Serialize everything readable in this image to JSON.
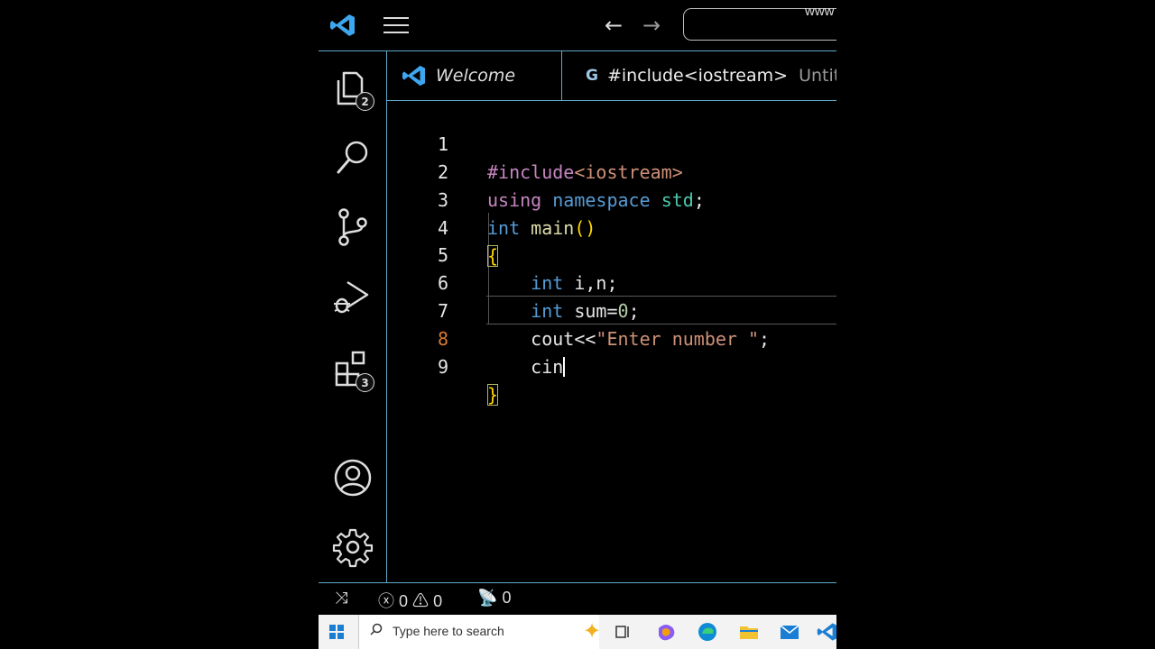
{
  "titlebar": {
    "search_text": "www",
    "back_icon": "arrow-left",
    "forward_icon": "arrow-right"
  },
  "activity_bar": {
    "explorer_badge": "2",
    "extensions_badge": "3"
  },
  "tabs": [
    {
      "label": "Welcome"
    },
    {
      "label": "#include<iostream>",
      "description": "Untitle"
    }
  ],
  "editor": {
    "active_line": 8,
    "lines": [
      {
        "num": "1",
        "code": "#include<iostream>"
      },
      {
        "num": "2",
        "code": "using namespace std;"
      },
      {
        "num": "3",
        "code": "int main()"
      },
      {
        "num": "4",
        "code": "{"
      },
      {
        "num": "5",
        "code": "    int i,n;"
      },
      {
        "num": "6",
        "code": "    int sum=0;"
      },
      {
        "num": "7",
        "code": "    cout<<\"Enter number \";"
      },
      {
        "num": "8",
        "code": "    cin"
      },
      {
        "num": "9",
        "code": "}"
      }
    ]
  },
  "status_bar": {
    "errors": "0",
    "warnings": "0",
    "ports": "0"
  },
  "taskbar": {
    "search_placeholder": "Type here to search"
  },
  "colors": {
    "accent_border": "#5fa8c8",
    "keyword": "#569cd6",
    "string": "#ce9178",
    "active_line_number": "#d67a33"
  }
}
